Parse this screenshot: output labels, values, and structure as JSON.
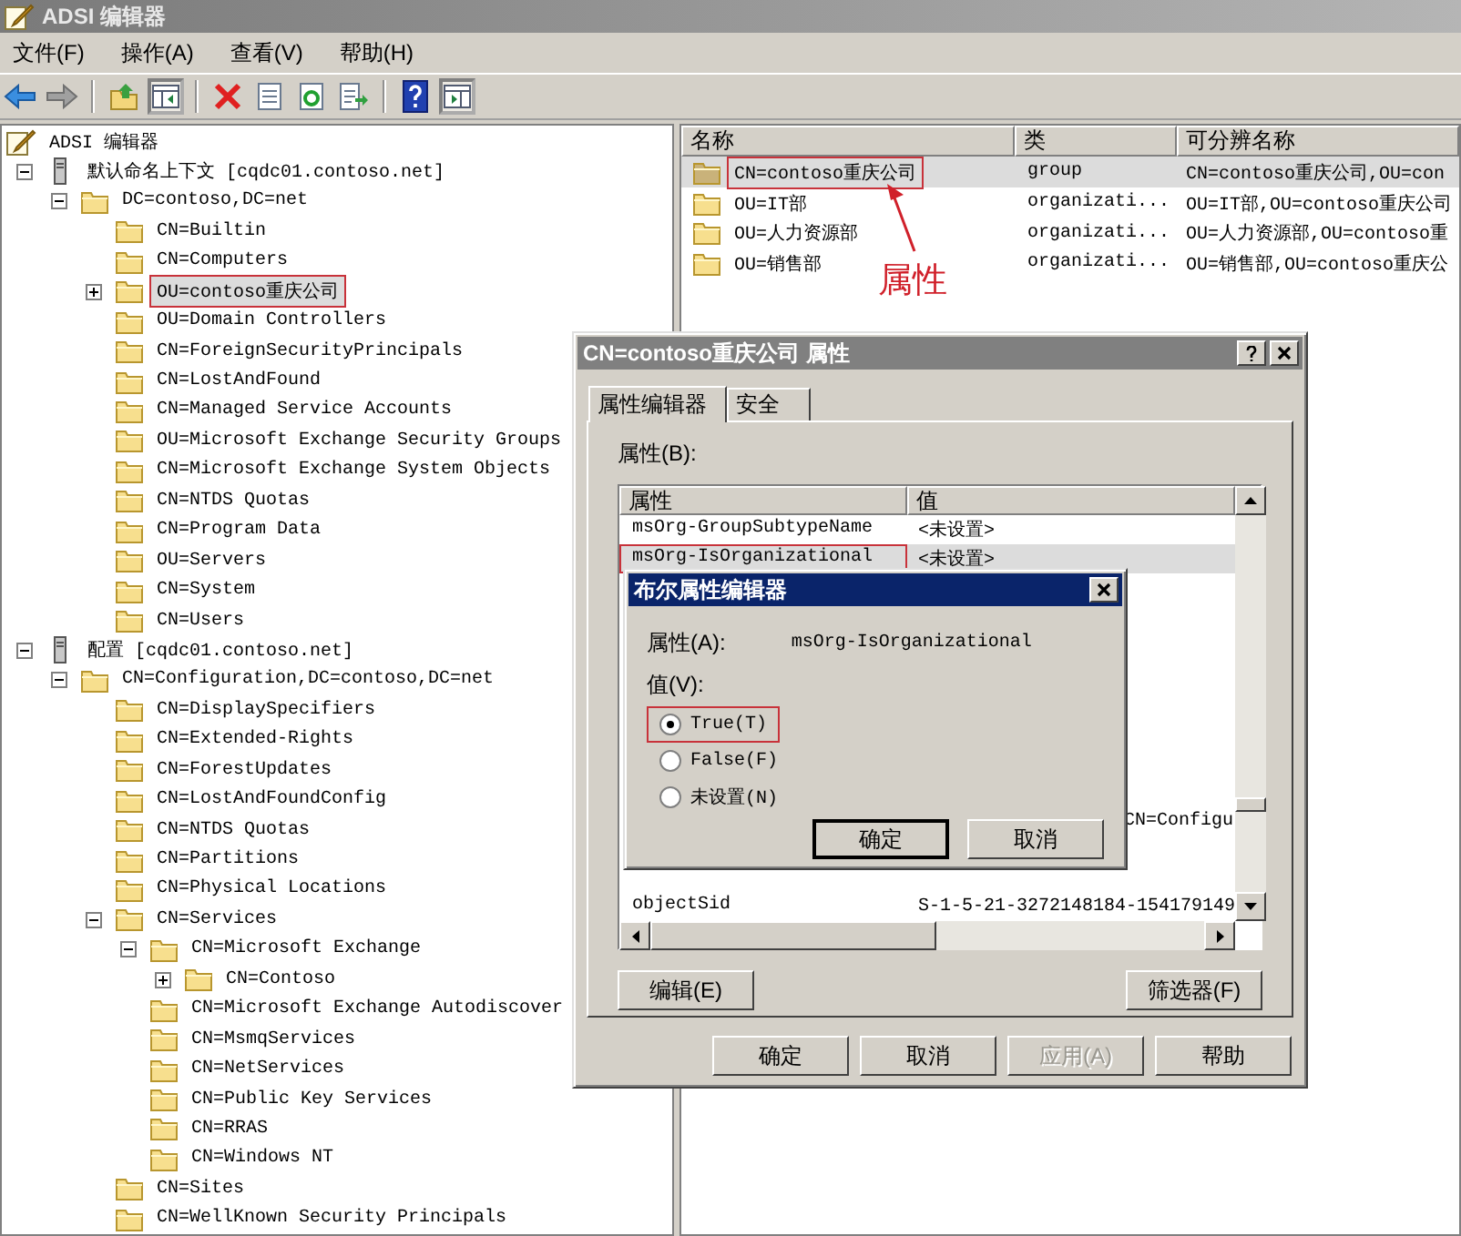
{
  "window": {
    "title": "ADSI 编辑器"
  },
  "menu": [
    "文件(F)",
    "操作(A)",
    "查看(V)",
    "帮助(H)"
  ],
  "toolbar": [
    {
      "pressed": false
    },
    {
      "pressed": false
    },
    {
      "pressed": false
    },
    {
      "pressed": true
    },
    {
      "pressed": false
    },
    {
      "pressed": false
    },
    {
      "pressed": false
    },
    {
      "pressed": false
    },
    {
      "pressed": false
    },
    {
      "pressed": true
    }
  ],
  "tree": {
    "label": "ADSI 编辑器",
    "kind": "app",
    "selected": false,
    "highlighted": false,
    "children": [
      {
        "label": "默认命名上下文 [cqdc01.contoso.net]",
        "kind": "server",
        "expanded": true,
        "selected": false,
        "highlighted": false,
        "children": [
          {
            "label": "DC=contoso,DC=net",
            "kind": "folder",
            "expanded": true,
            "selected": false,
            "highlighted": false,
            "children": [
              {
                "label": "CN=Builtin",
                "kind": "folder",
                "selected": false,
                "highlighted": false
              },
              {
                "label": "CN=Computers",
                "kind": "folder",
                "selected": false,
                "highlighted": false
              },
              {
                "label": "OU=contoso重庆公司",
                "kind": "folder",
                "expanded": false,
                "selected": true,
                "highlighted": true
              },
              {
                "label": "OU=Domain Controllers",
                "kind": "folder",
                "selected": false,
                "highlighted": false
              },
              {
                "label": "CN=ForeignSecurityPrincipals",
                "kind": "folder",
                "selected": false,
                "highlighted": false
              },
              {
                "label": "CN=LostAndFound",
                "kind": "folder",
                "selected": false,
                "highlighted": false
              },
              {
                "label": "CN=Managed Service Accounts",
                "kind": "folder",
                "selected": false,
                "highlighted": false
              },
              {
                "label": "OU=Microsoft Exchange Security Groups",
                "kind": "folder",
                "selected": false,
                "highlighted": false
              },
              {
                "label": "CN=Microsoft Exchange System Objects",
                "kind": "folder",
                "selected": false,
                "highlighted": false
              },
              {
                "label": "CN=NTDS Quotas",
                "kind": "folder",
                "selected": false,
                "highlighted": false
              },
              {
                "label": "CN=Program Data",
                "kind": "folder",
                "selected": false,
                "highlighted": false
              },
              {
                "label": "OU=Servers",
                "kind": "folder",
                "selected": false,
                "highlighted": false
              },
              {
                "label": "CN=System",
                "kind": "folder",
                "selected": false,
                "highlighted": false
              },
              {
                "label": "CN=Users",
                "kind": "folder",
                "selected": false,
                "highlighted": false
              }
            ]
          }
        ]
      },
      {
        "label": "配置 [cqdc01.contoso.net]",
        "kind": "server",
        "expanded": true,
        "selected": false,
        "highlighted": false,
        "children": [
          {
            "label": "CN=Configuration,DC=contoso,DC=net",
            "kind": "folder",
            "expanded": true,
            "selected": false,
            "highlighted": false,
            "children": [
              {
                "label": "CN=DisplaySpecifiers",
                "kind": "folder",
                "selected": false,
                "highlighted": false
              },
              {
                "label": "CN=Extended-Rights",
                "kind": "folder",
                "selected": false,
                "highlighted": false
              },
              {
                "label": "CN=ForestUpdates",
                "kind": "folder",
                "selected": false,
                "highlighted": false
              },
              {
                "label": "CN=LostAndFoundConfig",
                "kind": "folder",
                "selected": false,
                "highlighted": false
              },
              {
                "label": "CN=NTDS Quotas",
                "kind": "folder",
                "selected": false,
                "highlighted": false
              },
              {
                "label": "CN=Partitions",
                "kind": "folder",
                "selected": false,
                "highlighted": false
              },
              {
                "label": "CN=Physical Locations",
                "kind": "folder",
                "selected": false,
                "highlighted": false
              },
              {
                "label": "CN=Services",
                "kind": "folder",
                "expanded": true,
                "selected": false,
                "highlighted": false,
                "children": [
                  {
                    "label": "CN=Microsoft Exchange",
                    "kind": "folder",
                    "expanded": true,
                    "selected": false,
                    "highlighted": false,
                    "children": [
                      {
                        "label": "CN=Contoso",
                        "kind": "folder",
                        "expanded": false,
                        "selected": false,
                        "highlighted": false
                      }
                    ]
                  },
                  {
                    "label": "CN=Microsoft Exchange Autodiscover",
                    "kind": "folder",
                    "selected": false,
                    "highlighted": false
                  },
                  {
                    "label": "CN=MsmqServices",
                    "kind": "folder",
                    "selected": false,
                    "highlighted": false
                  },
                  {
                    "label": "CN=NetServices",
                    "kind": "folder",
                    "selected": false,
                    "highlighted": false
                  },
                  {
                    "label": "CN=Public Key Services",
                    "kind": "folder",
                    "selected": false,
                    "highlighted": false
                  },
                  {
                    "label": "CN=RRAS",
                    "kind": "folder",
                    "selected": false,
                    "highlighted": false
                  },
                  {
                    "label": "CN=Windows NT",
                    "kind": "folder",
                    "selected": false,
                    "highlighted": false
                  }
                ]
              },
              {
                "label": "CN=Sites",
                "kind": "folder",
                "selected": false,
                "highlighted": false
              },
              {
                "label": "CN=WellKnown Security Principals",
                "kind": "folder",
                "selected": false,
                "highlighted": false
              }
            ]
          }
        ]
      }
    ]
  },
  "list": {
    "columns": [
      "名称",
      "类",
      "可分辨名称"
    ],
    "rows": [
      {
        "name": "CN=contoso重庆公司",
        "class": "group",
        "dn": "CN=contoso重庆公司,OU=con",
        "selected": true,
        "highlighted": true
      },
      {
        "name": "OU=IT部",
        "class": "organizati...",
        "dn": "OU=IT部,OU=contoso重庆公司",
        "selected": false,
        "highlighted": false
      },
      {
        "name": "OU=人力资源部",
        "class": "organizati...",
        "dn": "OU=人力资源部,OU=contoso重",
        "selected": false,
        "highlighted": false
      },
      {
        "name": "OU=销售部",
        "class": "organizati...",
        "dn": "OU=销售部,OU=contoso重庆公",
        "selected": false,
        "highlighted": false
      }
    ]
  },
  "annotation": {
    "label": "属性"
  },
  "properties_dialog": {
    "title": "CN=contoso重庆公司 属性",
    "tabs": [
      {
        "label": "属性编辑器",
        "selected": true
      },
      {
        "label": "安全",
        "selected": false
      }
    ],
    "list_label": "属性(B):",
    "columns": [
      "属性",
      "值"
    ],
    "rows": [
      {
        "kind": "full",
        "attribute": "msOrg-GroupSubtypeName",
        "value": "<未设置>",
        "selected": false,
        "highlighted": false
      },
      {
        "kind": "full",
        "attribute": "msOrg-IsOrganizational",
        "value": "<未设置>",
        "selected": true,
        "highlighted": true
      },
      {
        "kind": "value_only",
        "value": "CN=Configu",
        "selected": false,
        "highlighted": false
      },
      {
        "kind": "full",
        "attribute": "objectSid",
        "value": "S-1-5-21-3272148184-154179149",
        "selected": false,
        "highlighted": false
      }
    ],
    "list_buttons": [
      "编辑(E)",
      "筛选器(F)"
    ],
    "buttons": [
      {
        "label": "确定",
        "disabled": false
      },
      {
        "label": "取消",
        "disabled": false
      },
      {
        "label": "应用(A)",
        "disabled": true
      },
      {
        "label": "帮助",
        "disabled": false
      }
    ]
  },
  "bool_dialog": {
    "title": "布尔属性编辑器",
    "attribute_label": "属性(A):",
    "attribute_value": "msOrg-IsOrganizational",
    "value_label": "值(V):",
    "options": [
      {
        "label": "True(T)",
        "selected": true,
        "highlighted": true
      },
      {
        "label": "False(F)",
        "selected": false,
        "highlighted": false
      },
      {
        "label": "未设置(N)",
        "selected": false,
        "highlighted": false
      }
    ],
    "buttons": [
      {
        "label": "确定",
        "default": true
      },
      {
        "label": "取消",
        "default": false
      }
    ]
  }
}
